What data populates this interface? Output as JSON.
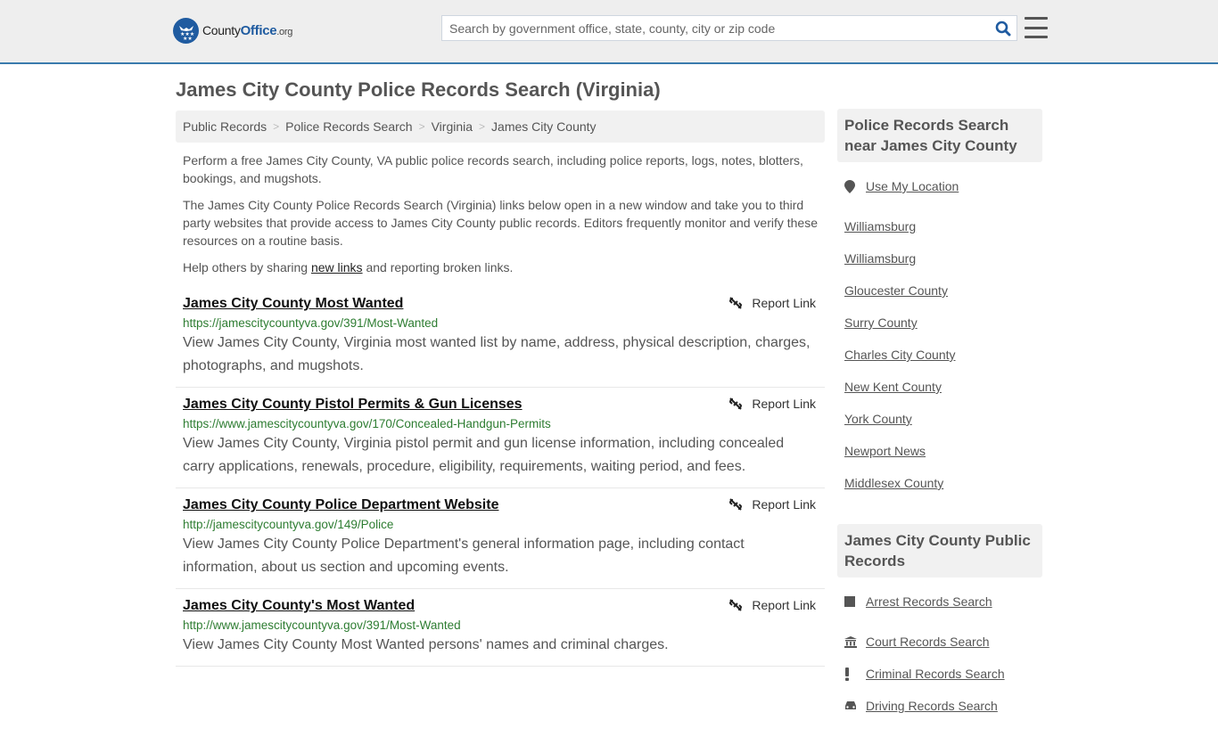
{
  "header": {
    "logo": {
      "name_part1": "County",
      "name_part2": "Office",
      "tld": ".org"
    },
    "search": {
      "placeholder": "Search by government office, state, county, city or zip code",
      "value": ""
    },
    "accent_color": "#3a7bad",
    "brand_color": "#1f5ba0"
  },
  "page": {
    "title": "James City County Police Records Search (Virginia)"
  },
  "breadcrumb": [
    {
      "label": "Public Records"
    },
    {
      "label": "Police Records Search"
    },
    {
      "label": "Virginia"
    },
    {
      "label": "James City County"
    }
  ],
  "intro": {
    "p1": "Perform a free James City County, VA public police records search, including police reports, logs, notes, blotters, bookings, and mugshots.",
    "p2": "The James City County Police Records Search (Virginia) links below open in a new window and take you to third party websites that provide access to James City County public records. Editors frequently monitor and verify these resources on a routine basis.",
    "p3_before": "Help others by sharing ",
    "p3_link": "new links",
    "p3_after": " and reporting broken links."
  },
  "results": [
    {
      "title": "James City County Most Wanted",
      "url": "https://jamescitycountyva.gov/391/Most-Wanted",
      "description": "View James City County, Virginia most wanted list by name, address, physical description, charges, photographs, and mugshots.",
      "report_label": "Report Link"
    },
    {
      "title": "James City County Pistol Permits & Gun Licenses",
      "url": "https://www.jamescitycountyva.gov/170/Concealed-Handgun-Permits",
      "description": "View James City County, Virginia pistol permit and gun license information, including concealed carry applications, renewals, procedure, eligibility, requirements, waiting period, and fees.",
      "report_label": "Report Link"
    },
    {
      "title": "James City County Police Department Website",
      "url": "http://jamescitycountyva.gov/149/Police",
      "description": "View James City County Police Department's general information page, including contact information, about us section and upcoming events.",
      "report_label": "Report Link"
    },
    {
      "title": "James City County's Most Wanted",
      "url": "http://www.jamescitycountyva.gov/391/Most-Wanted",
      "description": "View James City County Most Wanted persons' names and criminal charges.",
      "report_label": "Report Link"
    }
  ],
  "sidebar": {
    "nearby": {
      "heading": "Police Records Search near James City County",
      "use_location": "Use My Location",
      "items": [
        "Williamsburg",
        "Williamsburg",
        "Gloucester County",
        "Surry County",
        "Charles City County",
        "New Kent County",
        "York County",
        "Newport News",
        "Middlesex County"
      ]
    },
    "public_records": {
      "heading": "James City County Public Records",
      "items": [
        {
          "label": "Arrest Records Search",
          "icon": "square-icon"
        },
        {
          "label": "Court Records Search",
          "icon": "courthouse-icon"
        },
        {
          "label": "Criminal Records Search",
          "icon": "exclamation-icon"
        },
        {
          "label": "Driving Records Search",
          "icon": "car-icon"
        }
      ]
    }
  }
}
